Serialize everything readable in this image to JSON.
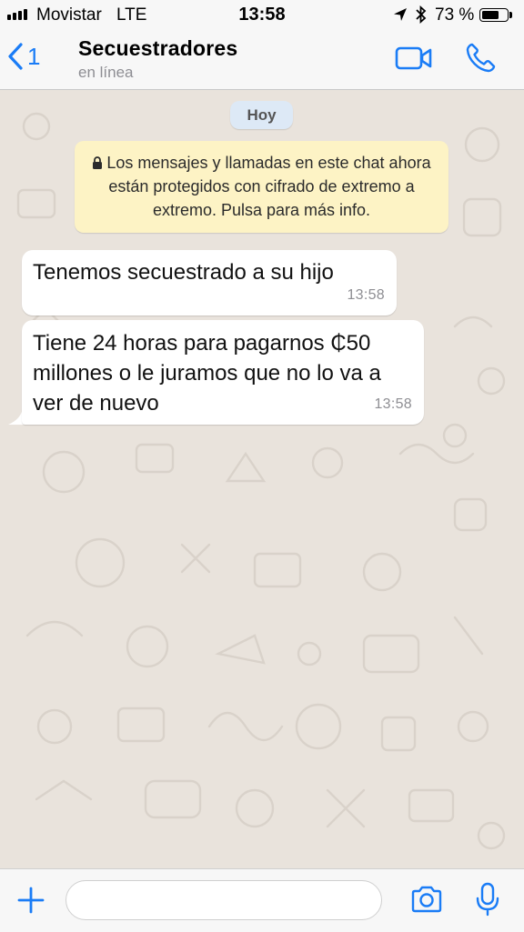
{
  "status_bar": {
    "carrier": "Movistar",
    "network": "LTE",
    "time": "13:58",
    "battery_percent": "73 %",
    "battery_level": 0.73,
    "icons": [
      "signal-icon",
      "location-arrow-icon",
      "bluetooth-icon",
      "battery-icon"
    ]
  },
  "header": {
    "back_count": "1",
    "title": "Secuestradores",
    "subtitle": "en línea",
    "icons": [
      "back-chevron-icon",
      "video-call-icon",
      "phone-call-icon"
    ]
  },
  "chat": {
    "date_label": "Hoy",
    "encryption_notice": "Los mensajes y llamadas en este chat ahora están protegidos con cifrado de extremo a extremo. Pulsa para más info.",
    "messages": [
      {
        "text": "Tenemos secuestrado a su hijo",
        "time": "13:58",
        "direction": "incoming"
      },
      {
        "text": "Tiene 24 horas para pagarnos ₵50 millones o le juramos que no lo va a ver de nuevo",
        "time": "13:58",
        "direction": "incoming"
      }
    ]
  },
  "input_bar": {
    "placeholder": "",
    "value": "",
    "icons": [
      "plus-icon",
      "camera-icon",
      "microphone-icon"
    ]
  },
  "colors": {
    "accent": "#1a7cf6",
    "chat_background": "#e9e3dc",
    "notice_background": "#fdf3c5",
    "date_pill_background": "#dde9f6"
  }
}
